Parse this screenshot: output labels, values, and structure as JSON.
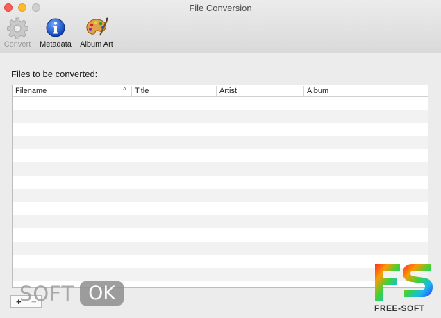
{
  "window": {
    "title": "File Conversion"
  },
  "toolbar": {
    "convert_label": "Convert",
    "metadata_label": "Metadata",
    "album_art_label": "Album Art"
  },
  "section_label": "Files to be converted:",
  "table": {
    "columns": [
      "Filename",
      "Title",
      "Artist",
      "Album"
    ],
    "sort_indicator": "^",
    "rows": []
  },
  "bottom": {
    "add_label": "+",
    "remove_label": "−"
  },
  "watermark": {
    "softok_left": "SOFT",
    "softok_right": "OK",
    "fs_logo": "FS",
    "fs_caption": "FREE-SOFT"
  },
  "colors": {
    "close": "#fc5f57",
    "minimize": "#fdbc2e",
    "metadata_icon": "#1f5fd6",
    "row_stripe": "#f2f2f2"
  },
  "icons": [
    "gear-icon",
    "info-icon",
    "palette-icon"
  ]
}
